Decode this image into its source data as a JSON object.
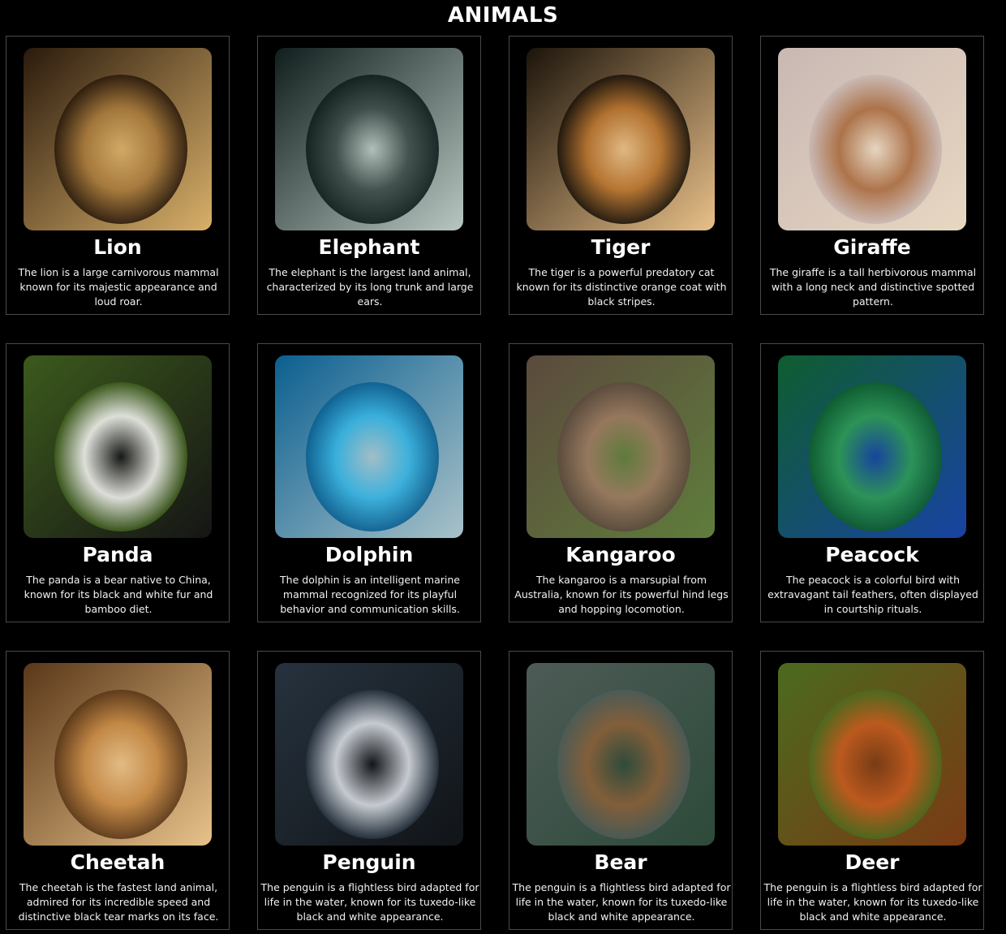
{
  "page": {
    "title": "ANIMALS"
  },
  "animals": [
    {
      "name": "Lion",
      "description": "The lion is a large carnivorous mammal known for its majestic appearance and loud roar.",
      "colors": [
        "#2a1a0c",
        "#a87a3c",
        "#d9b06a"
      ]
    },
    {
      "name": "Elephant",
      "description": "The elephant is the largest land animal, characterized by its long trunk and large ears.",
      "colors": [
        "#0f1e1c",
        "#3d4c48",
        "#b9c7c2"
      ]
    },
    {
      "name": "Tiger",
      "description": "The tiger is a powerful predatory cat known for its distinctive orange coat with black stripes.",
      "colors": [
        "#1b130a",
        "#b9742e",
        "#e9c089"
      ]
    },
    {
      "name": "Giraffe",
      "description": "The giraffe is a tall herbivorous mammal with a long neck and distinctive spotted pattern.",
      "colors": [
        "#c9b8b3",
        "#a86a3e",
        "#e8d7c2"
      ]
    },
    {
      "name": "Panda",
      "description": "The panda is a bear native to China, known for its black and white fur and bamboo diet.",
      "colors": [
        "#3c5a1c",
        "#f1f1ee",
        "#151515"
      ]
    },
    {
      "name": "Dolphin",
      "description": "The dolphin is an intelligent marine mammal recognized for its playful behavior and communication skills.",
      "colors": [
        "#0b5f90",
        "#37b3e0",
        "#a9c2c9"
      ]
    },
    {
      "name": "Kangaroo",
      "description": "The kangaroo is a marsupial from Australia, known for its powerful hind legs and hopping locomotion.",
      "colors": [
        "#5b4a3d",
        "#9c7b61",
        "#5f7d3c"
      ]
    },
    {
      "name": "Peacock",
      "description": "The peacock is a colorful bird with extravagant tail feathers, often displayed in courtship rituals.",
      "colors": [
        "#0f5d2f",
        "#2f9a55",
        "#1843a3"
      ]
    },
    {
      "name": "Cheetah",
      "description": "The cheetah is the fastest land animal, admired for its incredible speed and distinctive black tear marks on its face.",
      "colors": [
        "#5a3718",
        "#c78a45",
        "#e8c28a"
      ]
    },
    {
      "name": "Penguin",
      "description": "The penguin is a flightless bird adapted for life in the water, known for its tuxedo-like black and white appearance.",
      "colors": [
        "#26323e",
        "#d9dde3",
        "#111418"
      ]
    },
    {
      "name": "Bear",
      "description": "The penguin is a flightless bird adapted for life in the water, known for its tuxedo-like black and white appearance.",
      "colors": [
        "#4d5b56",
        "#8a6038",
        "#2d4a3a"
      ]
    },
    {
      "name": "Deer",
      "description": "The penguin is a flightless bird adapted for life in the water, known for its tuxedo-like black and white appearance.",
      "colors": [
        "#4b6a1e",
        "#c65a1f",
        "#7a3a14"
      ]
    }
  ]
}
